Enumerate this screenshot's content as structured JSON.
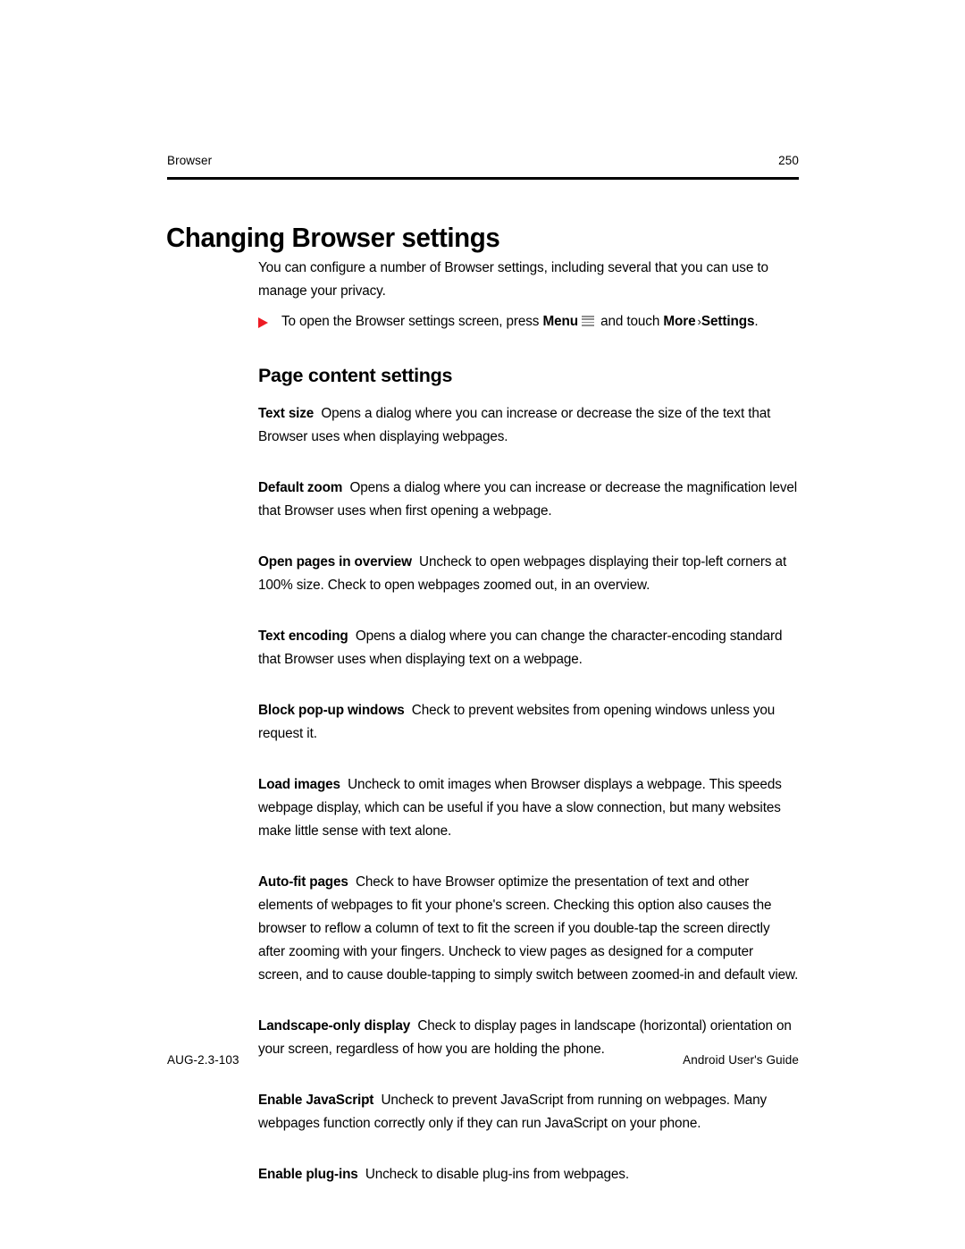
{
  "header": {
    "chapter": "Browser",
    "page_number": "250"
  },
  "title": "Changing Browser settings",
  "intro": {
    "paragraph": "You can configure a number of Browser settings, including several that you can use to manage your privacy."
  },
  "bullet": {
    "text_before_menu": "To open the Browser settings screen, press ",
    "menu_label": "Menu",
    "menu_icon": "menu-hamburger-icon",
    "text_after_menu": " and touch ",
    "more_label": "More",
    "chevron": "›",
    "settings_label": "Settings",
    "trailing_period": "."
  },
  "section": {
    "heading": "Page content settings",
    "settings": [
      {
        "term": "Text size",
        "description": "Opens a dialog where you can increase or decrease the size of the text that Browser uses when displaying webpages."
      },
      {
        "term": "Default zoom",
        "description": "Opens a dialog where you can increase or decrease the magnification level that Browser uses when first opening a webpage."
      },
      {
        "term": "Open pages in overview",
        "description": "Uncheck to open webpages displaying their top-left corners at 100% size. Check to open webpages zoomed out, in an overview."
      },
      {
        "term": "Text encoding",
        "description": "Opens a dialog where you can change the character-encoding standard that Browser uses when displaying text on a webpage."
      },
      {
        "term": "Block pop-up windows",
        "description": "Check to prevent websites from opening windows unless you request it."
      },
      {
        "term": "Load images",
        "description": "Uncheck to omit images when Browser displays a webpage. This speeds webpage display, which can be useful if you have a slow connection, but many websites make little sense with text alone."
      },
      {
        "term": "Auto-fit pages",
        "description": "Check to have Browser optimize the presentation of text and other elements of webpages to fit your phone's screen. Checking this option also causes the browser to reflow a column of text to fit the screen if you double-tap the screen directly after zooming with your fingers. Uncheck to view pages as designed for a computer screen, and to cause double-tapping to simply switch between zoomed-in and default view."
      },
      {
        "term": "Landscape-only display",
        "description": "Check to display pages in landscape (horizontal) orientation on your screen, regardless of how you are holding the phone."
      },
      {
        "term": "Enable JavaScript",
        "description": "Uncheck to prevent JavaScript from running on webpages. Many webpages function correctly only if they can run JavaScript on your phone."
      },
      {
        "term": "Enable plug-ins",
        "description": "Uncheck to disable plug-ins from webpages."
      }
    ]
  },
  "footer": {
    "doc_id": "AUG-2.3-103",
    "doc_title": "Android User's Guide"
  },
  "colors": {
    "bullet_red": "#ed1b24",
    "text": "#000000",
    "background": "#ffffff",
    "menu_icon_grey": "#8f8f8f"
  }
}
